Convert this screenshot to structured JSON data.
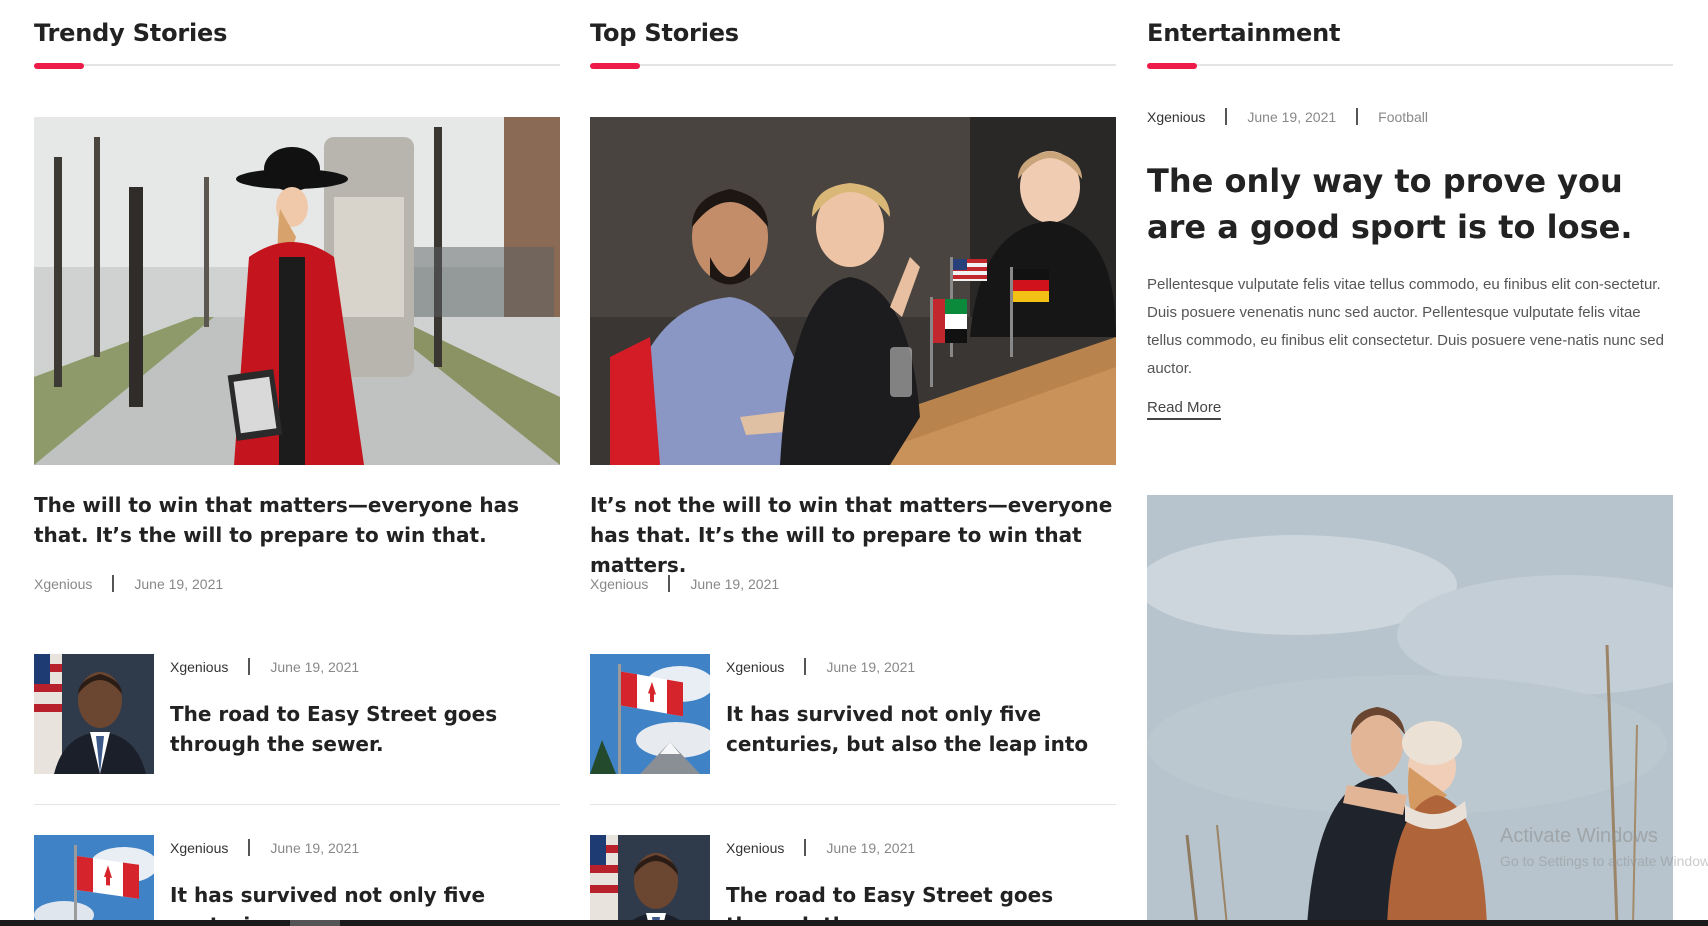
{
  "colors": {
    "accent": "#ee1b48",
    "text": "#222222",
    "meta": "#888888",
    "divider": "#e4e4e4"
  },
  "columns": [
    {
      "heading": "Trendy Stories",
      "hero": {
        "image": "woman-in-red-coat-photo",
        "title": "The will to win that matters—everyone has that. It’s the will to prepare to win that.",
        "author": "Xgenious",
        "date": "June 19, 2021"
      },
      "items": [
        {
          "image": "portrait-man-with-flag-photo",
          "author": "Xgenious",
          "date": "June 19, 2021",
          "title": "The road to Easy Street goes through the sewer."
        },
        {
          "image": "canada-flag-photo",
          "author": "Xgenious",
          "date": "June 19, 2021",
          "title": "It has survived not only five centuries,"
        }
      ]
    },
    {
      "heading": "Top Stories",
      "hero": {
        "image": "business-meeting-photo",
        "title": "It’s not the will to win that matters—everyone has that. It’s the will to prepare to win that matters.",
        "author": "Xgenious",
        "date": "June 19, 2021"
      },
      "items": [
        {
          "image": "canada-flag-photo",
          "author": "Xgenious",
          "date": "June 19, 2021",
          "title": "It has survived not only five centuries, but also the leap into"
        },
        {
          "image": "portrait-man-with-flag-photo",
          "author": "Xgenious",
          "date": "June 19, 2021",
          "title": "The road to Easy Street goes through the"
        }
      ]
    },
    {
      "heading": "Entertainment",
      "feature": {
        "author": "Xgenious",
        "date": "June 19, 2021",
        "category": "Football",
        "title": "The only way to prove you are a good sport is to lose.",
        "description": "Pellentesque vulputate felis vitae tellus commodo, eu finibus elit con-sectetur. Duis posuere venenatis nunc sed auctor. Pellentesque vulputate felis vitae tellus commodo, eu finibus elit consectetur. Duis posuere vene-natis nunc sed auctor.",
        "read_more": "Read More",
        "image": "couple-in-field-photo"
      }
    }
  ],
  "watermark": {
    "title": "Activate Windows",
    "subtitle": "Go to Settings to activate Windows."
  }
}
